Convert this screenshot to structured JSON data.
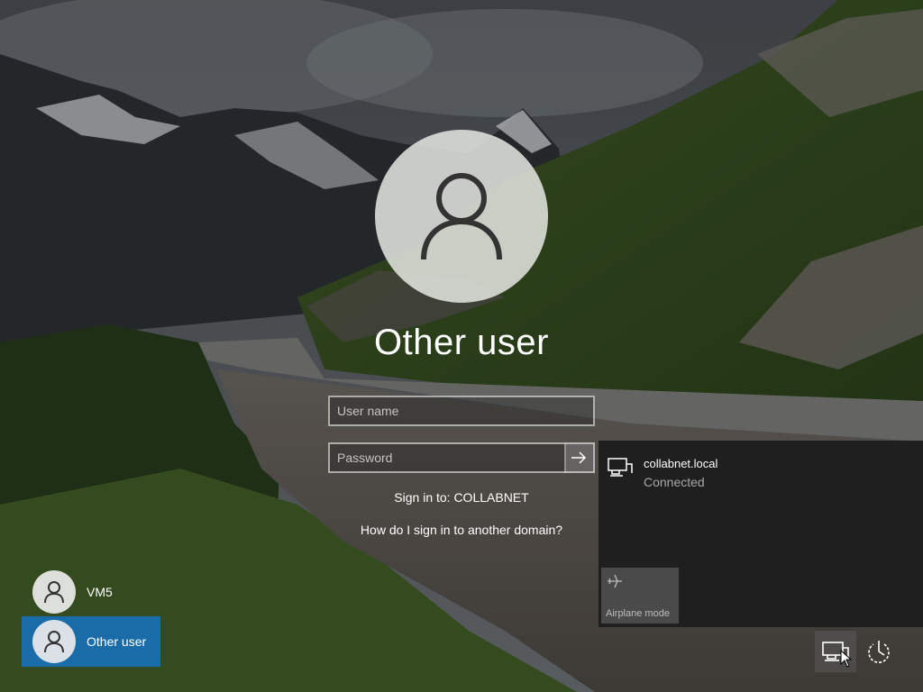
{
  "login": {
    "title": "Other user",
    "username_placeholder": "User name",
    "password_placeholder": "Password",
    "sign_in_to": "Sign in to: COLLABNET",
    "domain_help_link": "How do I sign in to another domain?"
  },
  "users": [
    {
      "name": "VM5",
      "selected": false
    },
    {
      "name": "Other user",
      "selected": true
    }
  ],
  "network_flyout": {
    "network_name": "collabnet.local",
    "network_status": "Connected",
    "airplane_mode_label": "Airplane mode"
  },
  "icons": {
    "avatar": "user-silhouette-icon",
    "submit": "arrow-right-icon",
    "network": "ethernet-network-icon",
    "airplane": "airplane-icon",
    "power": "power-icon"
  },
  "colors": {
    "selected_tile": "#1a6ca8",
    "flyout_bg": "#1f1f1f",
    "airplane_tile": "#4a4a4a",
    "status_text": "#a9a9a9"
  }
}
